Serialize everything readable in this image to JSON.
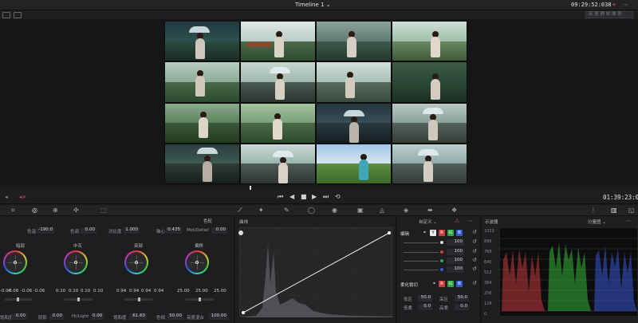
{
  "topbar": {
    "title": "Timeline 1 ⌄",
    "timecode": "09:29:52:038"
  },
  "search": {
    "placeholder": "高 速 静 帧 搜 索"
  },
  "transport": {
    "timecode": "01:39:23:012"
  },
  "wheels": {
    "top_params": [
      {
        "label": "色温",
        "value": "-190.0"
      },
      {
        "label": "色调",
        "value": "0.00"
      },
      {
        "label": "对比度",
        "value": "1.000"
      },
      {
        "label": "轴心",
        "value": "0.435"
      },
      {
        "label": "Mid/Detail",
        "value": "0.00"
      }
    ],
    "panel_label": "色轮",
    "items": [
      {
        "label": "暗部",
        "values": [
          "-0.06",
          "-0.08",
          "-0.06",
          "-0.06"
        ]
      },
      {
        "label": "中灰",
        "values": [
          "0.10",
          "0.10",
          "0.10",
          "0.10"
        ]
      },
      {
        "label": "亮部",
        "values": [
          "0.94",
          "0.94",
          "0.94",
          "0.94"
        ]
      },
      {
        "label": "偏移",
        "values": [
          "25.00",
          "25.00",
          "25.00"
        ]
      }
    ],
    "bottom_params": [
      {
        "label": "饱和度",
        "value": "0.00"
      },
      {
        "label": "阴影",
        "value": "0.00"
      },
      {
        "label": "Hi/Light",
        "value": "0.00"
      },
      {
        "label": "饱和度",
        "value": "61.60"
      },
      {
        "label": "色相",
        "value": "50.00"
      },
      {
        "label": "亮度混合",
        "value": "100.00"
      }
    ]
  },
  "curves": {
    "title": "曲线",
    "mode": "自定义 ⌄"
  },
  "qualifier": {
    "edit_label": "编辑",
    "channels": [
      {
        "value": "100"
      },
      {
        "value": "100"
      },
      {
        "value": "100"
      },
      {
        "value": "100"
      }
    ],
    "soft_label": "柔化裁切",
    "soft_params": [
      {
        "label": "低区",
        "value": "50.0"
      },
      {
        "label": "高区",
        "value": "50.0"
      },
      {
        "label": "低柔",
        "value": "0.0"
      },
      {
        "label": "高柔",
        "value": "0.0"
      }
    ]
  },
  "scope": {
    "title": "示波器",
    "mode": "分量图 ⌄",
    "scale": [
      "1023",
      "896",
      "768",
      "640",
      "512",
      "384",
      "256",
      "128",
      "0"
    ]
  },
  "colors": {
    "accent_red": "#d24c4c",
    "channel_r": "#d03a3a",
    "channel_g": "#2fa84a",
    "channel_b": "#2f5ad8"
  }
}
